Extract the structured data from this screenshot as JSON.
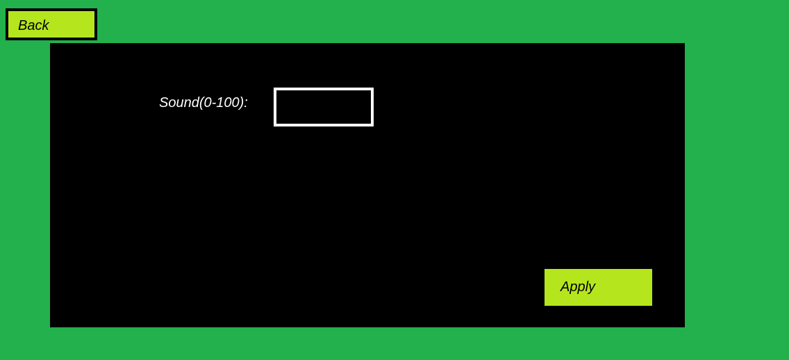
{
  "colors": {
    "background": "#22b14c",
    "panel": "#000000",
    "button": "#b5e61d",
    "button_border": "#000000",
    "text_light": "#ffffff",
    "text_dark": "#000000"
  },
  "header": {
    "back_label": "Back"
  },
  "settings": {
    "sound_label": "Sound(0-100):",
    "sound_value": "",
    "sound_placeholder": ""
  },
  "footer": {
    "apply_label": "Apply"
  }
}
